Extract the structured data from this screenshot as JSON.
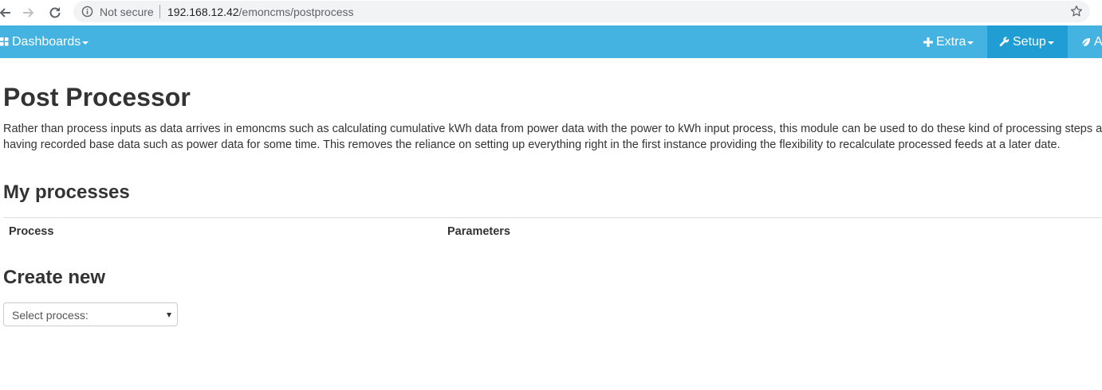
{
  "browser": {
    "security_label": "Not secure",
    "url_host": "192.168.12.42",
    "url_path": "/emoncms/postprocess"
  },
  "nav": {
    "dashboards_label": "Dashboards",
    "extra_label": "Extra",
    "setup_label": "Setup",
    "more_label": "A",
    "bar_color": "#44b3e2",
    "active_color": "#209ed3"
  },
  "page": {
    "title": "Post Processor",
    "intro": "Rather than process inputs as data arrives in emoncms such as calculating cumulative kWh data from power data with the power to kWh input process, this module can be used to do these kind of processing steps after having recorded base data such as power data for some time. This removes the reliance on setting up everything right in the first instance providing the flexibility to recalculate processed feeds at a later date.",
    "my_processes_heading": "My processes",
    "table": {
      "columns": [
        "Process",
        "Parameters"
      ]
    },
    "create_heading": "Create new",
    "select_placeholder": "Select process:"
  },
  "icons": {
    "back": "back-arrow-icon",
    "forward": "forward-arrow-icon",
    "reload": "reload-icon",
    "info": "info-icon",
    "bookmark": "star-icon",
    "dashboards": "grid-icon",
    "extra": "plus-icon",
    "setup": "wrench-icon",
    "more": "leaf-icon"
  }
}
